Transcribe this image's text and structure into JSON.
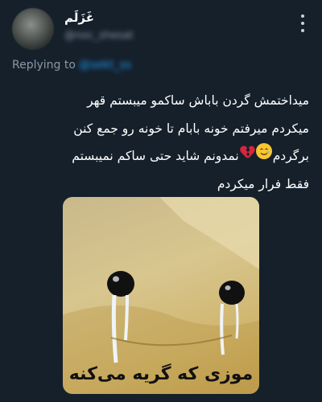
{
  "tweet": {
    "display_name": "غَزَلَم",
    "handle": "@noc_shesat",
    "replying_label": "Replying to",
    "replying_handle": "@sekt_ss",
    "text_lines": [
      "میداختمش گردن باباش ساکمو میبستم قهر",
      "میکردم میرفتم خونه بابام تا خونه رو جمع کنن",
      "برگردم",
      "نمدونم شاید حتی ساکم نمیبستم",
      "فقط فرار میکردم"
    ],
    "emojis": {
      "face": "smiling-face-with-tear",
      "heart": "broken-heart"
    },
    "media": {
      "caption": "موزی که گریه می‌کنه",
      "description_icon": "crying-banana-meme"
    }
  },
  "colors": {
    "background": "#15202b",
    "secondary_text": "#8b98a5",
    "link": "#1d9bf0"
  }
}
